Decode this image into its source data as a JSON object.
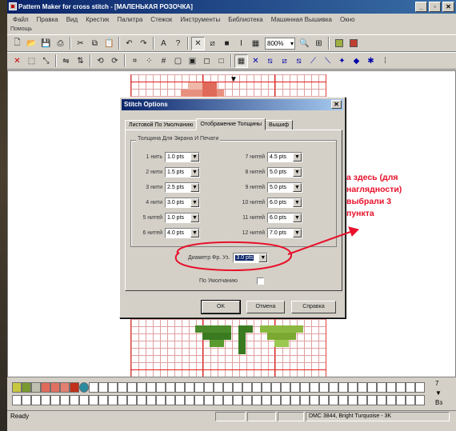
{
  "window": {
    "title": "Pattern Maker for cross stitch - [МАЛЕНЬКАЯ РОЗОЧКА]",
    "buttons": [
      "_",
      "▫",
      "✕"
    ]
  },
  "menu": [
    "Файл",
    "Правка",
    "Вид",
    "Крестик",
    "Палитра",
    "Стежок",
    "Инструменты",
    "Библиотека",
    "Машинная Вышивка",
    "Окно"
  ],
  "help_bar": "Помощь",
  "toolbar": {
    "zoom": "800%"
  },
  "dialog": {
    "title": "Stitch Options",
    "close": "✕",
    "tabs": [
      {
        "label": "Листовой По Умолчанию",
        "active": false
      },
      {
        "label": "Отображение Толщины",
        "active": true
      },
      {
        "label": "Вышиф",
        "active": false
      }
    ],
    "group_title": "Толщина Для Экрана И Печати",
    "left_rows": [
      {
        "label": "1 нить",
        "value": "1.0 pts"
      },
      {
        "label": "2 нити",
        "value": "1.5 pts"
      },
      {
        "label": "3 нити",
        "value": "2.5 pts"
      },
      {
        "label": "4 нити",
        "value": "3.0 pts"
      },
      {
        "label": "5 нитей",
        "value": "1.0 pts"
      },
      {
        "label": "6 нитей",
        "value": "4.0 pts"
      }
    ],
    "right_rows": [
      {
        "label": "7 нитей",
        "value": "4.5 pts"
      },
      {
        "label": "8 нитей",
        "value": "5.0 pts"
      },
      {
        "label": "9 нитей",
        "value": "5.0 pts"
      },
      {
        "label": "10 нитей",
        "value": "6.0 pts"
      },
      {
        "label": "11 нитей",
        "value": "6.0 pts"
      },
      {
        "label": "12 нитей",
        "value": "7.0 pts"
      }
    ],
    "diameter_label": "Диаметр Фр. Уз.",
    "diameter_value": "3.0 pts",
    "default_label": "По Умолчанию",
    "ok": "OK",
    "cancel": "Отмена",
    "help": "Справка"
  },
  "annotation": {
    "lines": [
      "а здесь (для",
      "наглядности)",
      "выбрали 3",
      "пункта"
    ],
    "color": "#e8102a"
  },
  "palette": {
    "colors": [
      "#c8c840",
      "#7a9a30",
      "#c0c0b0",
      "#e06a5a",
      "#e07060",
      "#e08070",
      "#c0301a",
      "#2a8aa0"
    ],
    "side": [
      "7",
      "▼",
      "Вз"
    ]
  },
  "status": {
    "left": "Ready",
    "color_info": "DMC 3844, Bright Turquoise - 3K"
  }
}
